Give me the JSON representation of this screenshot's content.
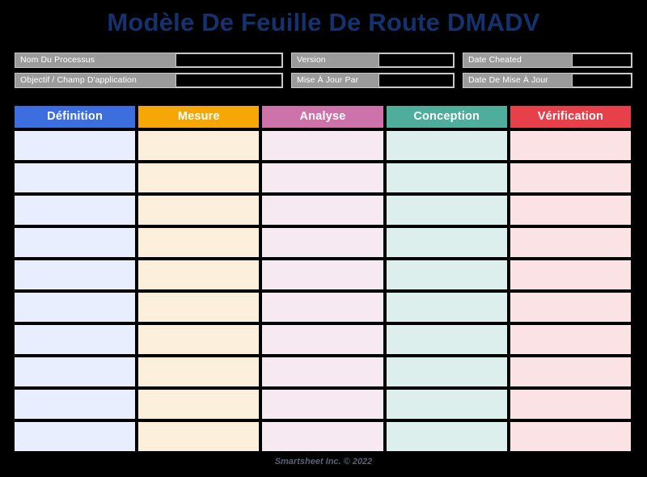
{
  "page": {
    "title": "Modèle De Feuille De Route DMADV",
    "background_color": "#000000",
    "title_color": "#13326E"
  },
  "meta": {
    "rows": [
      [
        {
          "label": "Nom Du Processus",
          "value": "",
          "size": "wide"
        },
        {
          "label": "Version",
          "value": "",
          "size": "mid"
        },
        {
          "label": "Date Cheated",
          "value": "",
          "size": "right"
        }
      ],
      [
        {
          "label": "Objectif / Champ D'application",
          "value": "",
          "size": "wide"
        },
        {
          "label": "Mise À Jour Par",
          "value": "",
          "size": "mid"
        },
        {
          "label": "Date De Mise À Jour",
          "value": "",
          "size": "right"
        }
      ]
    ],
    "label_background": "#9b9b9b",
    "input_background": "#000000"
  },
  "board": {
    "row_count": 10,
    "columns": [
      {
        "label": "Définition",
        "header_color": "#3D6EE0",
        "cell_color": "#E8EEFD"
      },
      {
        "label": "Mesure",
        "header_color": "#F5A706",
        "cell_color": "#FCF0DC"
      },
      {
        "label": "Analyse",
        "header_color": "#CE72AA",
        "cell_color": "#F7E9F1"
      },
      {
        "label": "Conception",
        "header_color": "#4FAE9B",
        "cell_color": "#DDEFEC"
      },
      {
        "label": "Vérification",
        "header_color": "#E8404A",
        "cell_color": "#FBE2E5"
      }
    ]
  },
  "footer": {
    "text": "Smartsheet Inc. © 2022"
  }
}
